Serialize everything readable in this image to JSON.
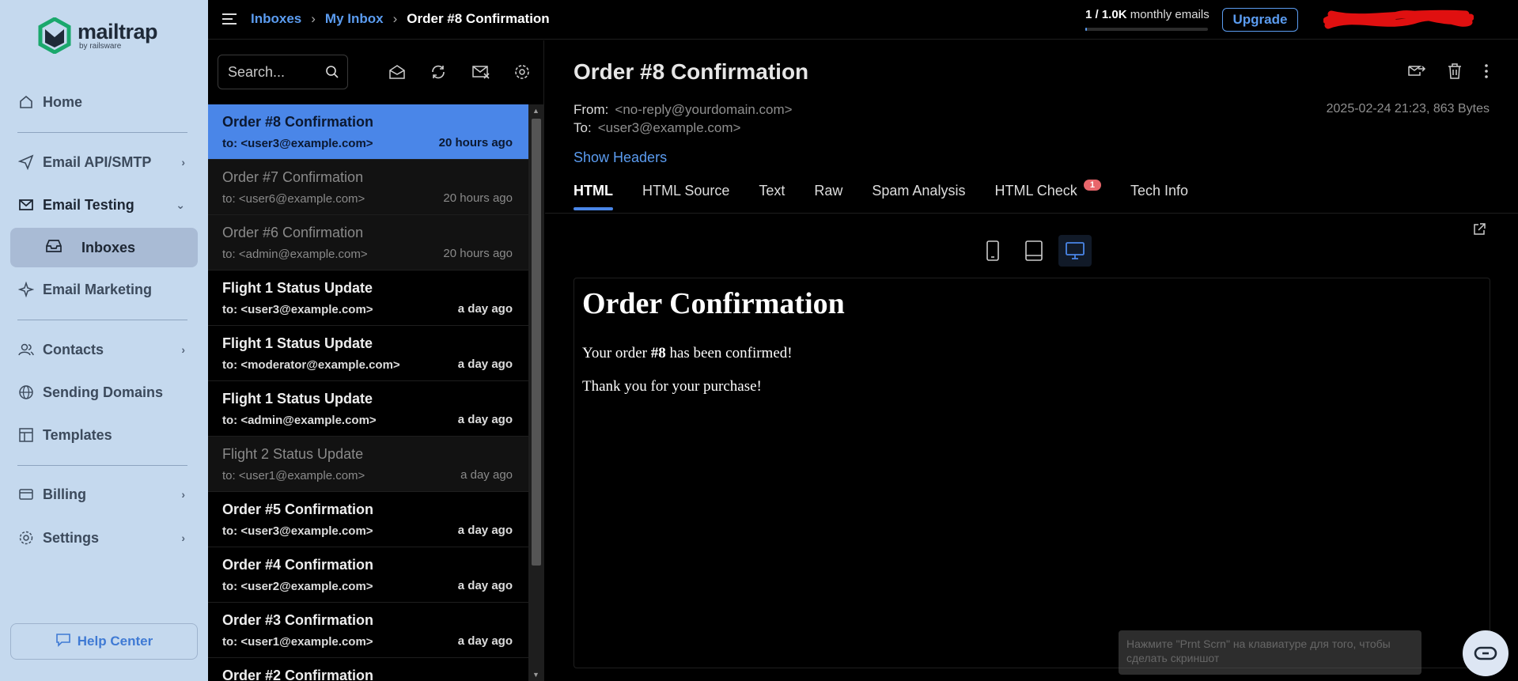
{
  "brand": {
    "name": "mailtrap",
    "sub": "by railsware"
  },
  "sidebar": {
    "items": [
      {
        "label": "Home"
      },
      {
        "label": "Email API/SMTP"
      },
      {
        "label": "Email Testing"
      },
      {
        "label": "Inboxes"
      },
      {
        "label": "Email Marketing"
      },
      {
        "label": "Contacts"
      },
      {
        "label": "Sending Domains"
      },
      {
        "label": "Templates"
      },
      {
        "label": "Billing"
      },
      {
        "label": "Settings"
      }
    ],
    "help": "Help Center"
  },
  "breadcrumb": {
    "inboxes": "Inboxes",
    "my_inbox": "My Inbox",
    "current": "Order #8 Confirmation"
  },
  "usage": {
    "used": "1 / 1.0K",
    "suffix": "monthly emails",
    "fraction": 0.001
  },
  "upgrade": "Upgrade",
  "search": {
    "placeholder": "Search..."
  },
  "messages": [
    {
      "subject": "Order #8 Confirmation",
      "to": "to: <user3@example.com>",
      "time": "20 hours ago",
      "state": "selected"
    },
    {
      "subject": "Order #7 Confirmation",
      "to": "to: <user6@example.com>",
      "time": "20 hours ago",
      "state": "read"
    },
    {
      "subject": "Order #6 Confirmation",
      "to": "to: <admin@example.com>",
      "time": "20 hours ago",
      "state": "read"
    },
    {
      "subject": "Flight 1 Status Update",
      "to": "to: <user3@example.com>",
      "time": "a day ago",
      "state": "unread"
    },
    {
      "subject": "Flight 1 Status Update",
      "to": "to: <moderator@example.com>",
      "time": "a day ago",
      "state": "unread"
    },
    {
      "subject": "Flight 1 Status Update",
      "to": "to: <admin@example.com>",
      "time": "a day ago",
      "state": "unread"
    },
    {
      "subject": "Flight 2 Status Update",
      "to": "to: <user1@example.com>",
      "time": "a day ago",
      "state": "read"
    },
    {
      "subject": "Order #5 Confirmation",
      "to": "to: <user3@example.com>",
      "time": "a day ago",
      "state": "unread"
    },
    {
      "subject": "Order #4 Confirmation",
      "to": "to: <user2@example.com>",
      "time": "a day ago",
      "state": "unread"
    },
    {
      "subject": "Order #3 Confirmation",
      "to": "to: <user1@example.com>",
      "time": "a day ago",
      "state": "unread"
    },
    {
      "subject": "Order #2 Confirmation",
      "to": "",
      "time": "",
      "state": "unread"
    }
  ],
  "detail": {
    "title": "Order #8 Confirmation",
    "from_label": "From:",
    "from": "<no-reply@yourdomain.com>",
    "to_label": "To:",
    "to": "<user3@example.com>",
    "meta": "2025-02-24 21:23, 863 Bytes",
    "show_headers": "Show Headers",
    "tabs": [
      {
        "label": "HTML",
        "active": true
      },
      {
        "label": "HTML Source"
      },
      {
        "label": "Text"
      },
      {
        "label": "Raw"
      },
      {
        "label": "Spam Analysis"
      },
      {
        "label": "HTML Check",
        "badge": "1"
      },
      {
        "label": "Tech Info"
      }
    ],
    "email": {
      "heading": "Order Confirmation",
      "line1_pre": "Your order ",
      "line1_bold": "#8",
      "line1_post": " has been confirmed!",
      "line2": "Thank you for your purchase!"
    }
  },
  "toast": "Нажмите \"Prnt Scrn\" на клавиатуре для того, чтобы сделать скриншот",
  "colors": {
    "accent": "#4a86e8",
    "sidebar_bg": "#c5d9ee",
    "badge": "#e8666b"
  }
}
